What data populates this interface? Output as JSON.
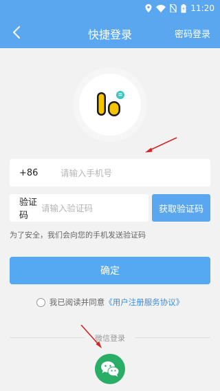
{
  "status_bar": {
    "time": "11:20"
  },
  "nav": {
    "title": "快捷登录",
    "right_label": "密码登录"
  },
  "form": {
    "country_code": "+86",
    "phone_placeholder": "请输入手机号",
    "verify_label": "验证码",
    "verify_placeholder": "请输入验证码",
    "get_code_label": "获取验证码",
    "hint": "为了安全，我们会向您的手机发送验证码",
    "confirm_label": "确定"
  },
  "agreement": {
    "text": "我已阅读并同意",
    "link": "《用户注册服务协议》"
  },
  "wechat": {
    "label": "微信登录"
  },
  "colors": {
    "primary": "#5aa7f0",
    "wechat_green": "#2aae67",
    "annotation_red": "#d42323"
  }
}
